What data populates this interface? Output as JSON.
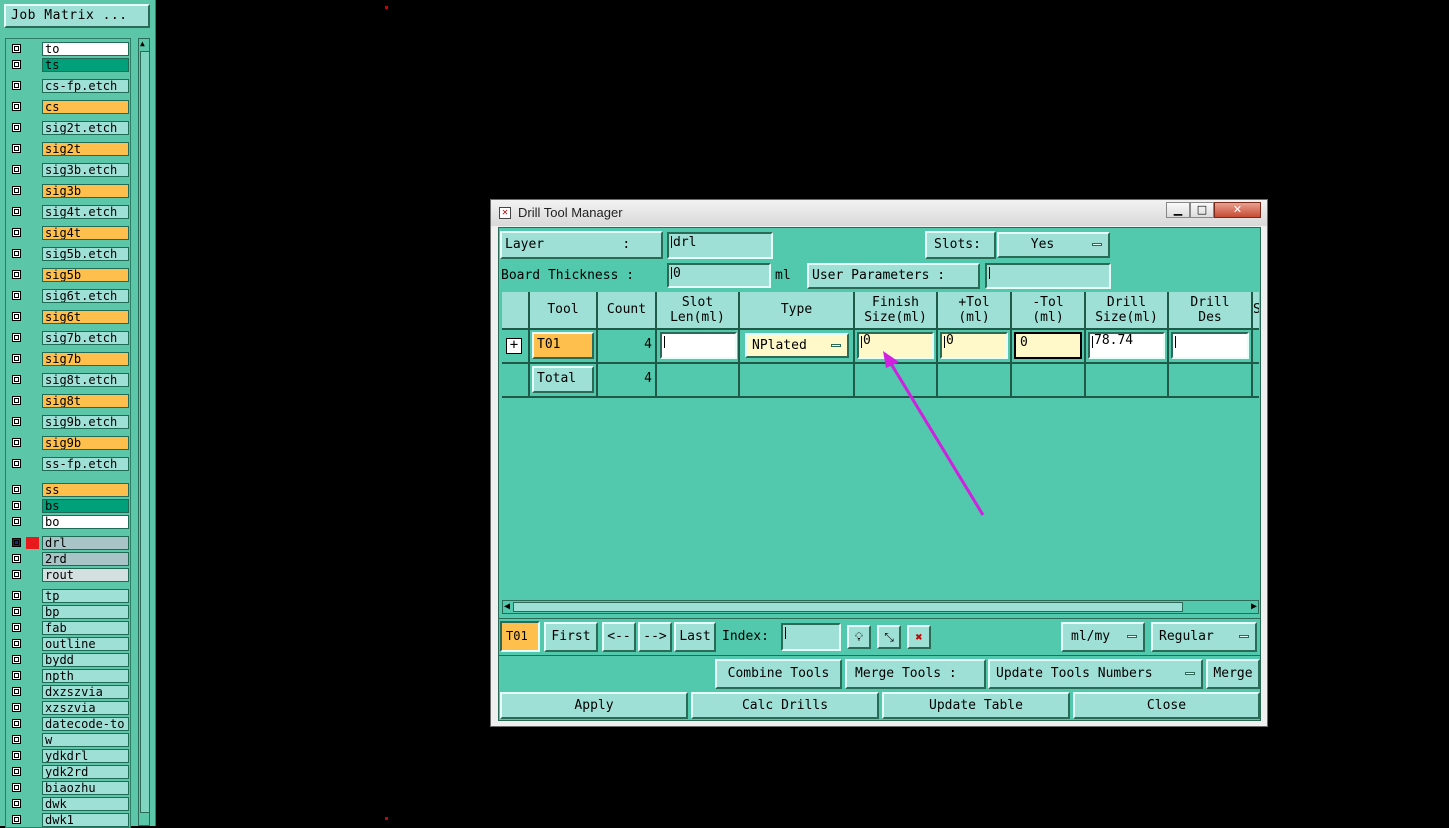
{
  "matrix_button": "Job Matrix ...",
  "layers": [
    {
      "name": "to",
      "color": "white",
      "gap": false
    },
    {
      "name": "ts",
      "color": "green",
      "gap": false
    },
    {
      "name": "cs-fp.etch",
      "color": "teal",
      "gap": true
    },
    {
      "name": "cs",
      "color": "orange",
      "gap": false
    },
    {
      "name": "sig2t.etch",
      "color": "teal",
      "gap": false
    },
    {
      "name": "sig2t",
      "color": "orange",
      "gap": false
    },
    {
      "name": "sig3b.etch",
      "color": "teal",
      "gap": false
    },
    {
      "name": "sig3b",
      "color": "orange",
      "gap": false
    },
    {
      "name": "sig4t.etch",
      "color": "teal",
      "gap": false
    },
    {
      "name": "sig4t",
      "color": "orange",
      "gap": false
    },
    {
      "name": "sig5b.etch",
      "color": "teal",
      "gap": false
    },
    {
      "name": "sig5b",
      "color": "orange",
      "gap": false
    },
    {
      "name": "sig6t.etch",
      "color": "teal",
      "gap": false
    },
    {
      "name": "sig6t",
      "color": "orange",
      "gap": false
    },
    {
      "name": "sig7b.etch",
      "color": "teal",
      "gap": false
    },
    {
      "name": "sig7b",
      "color": "orange",
      "gap": false
    },
    {
      "name": "sig8t.etch",
      "color": "teal",
      "gap": false
    },
    {
      "name": "sig8t",
      "color": "orange",
      "gap": false
    },
    {
      "name": "sig9b.etch",
      "color": "teal",
      "gap": false
    },
    {
      "name": "sig9b",
      "color": "orange",
      "gap": false
    },
    {
      "name": "ss-fp.etch",
      "color": "teal",
      "gap": false
    },
    {
      "name": "ss",
      "color": "orange",
      "gap": true
    },
    {
      "name": "bs",
      "color": "green",
      "gap": false
    },
    {
      "name": "bo",
      "color": "white",
      "gap": false
    },
    {
      "name": "drl",
      "color": "gray",
      "gap": true,
      "active": true
    },
    {
      "name": "2rd",
      "color": "gray",
      "gap": false
    },
    {
      "name": "rout",
      "color": "lgray",
      "gap": false
    },
    {
      "name": "tp",
      "color": "teal",
      "gap": true
    },
    {
      "name": "bp",
      "color": "teal",
      "gap": false
    },
    {
      "name": "fab",
      "color": "teal",
      "gap": false
    },
    {
      "name": "outline",
      "color": "teal",
      "gap": false
    },
    {
      "name": "bydd",
      "color": "teal",
      "gap": false
    },
    {
      "name": "npth",
      "color": "teal",
      "gap": false
    },
    {
      "name": "dxzszvia",
      "color": "teal",
      "gap": false
    },
    {
      "name": "xzszvia",
      "color": "teal",
      "gap": false
    },
    {
      "name": "datecode-to",
      "color": "teal",
      "gap": false
    },
    {
      "name": "w",
      "color": "teal",
      "gap": false
    },
    {
      "name": "ydkdrl",
      "color": "teal",
      "gap": false
    },
    {
      "name": "ydk2rd",
      "color": "teal",
      "gap": false
    },
    {
      "name": "biaozhu",
      "color": "teal",
      "gap": false
    },
    {
      "name": "dwk",
      "color": "teal",
      "gap": false
    },
    {
      "name": "dwk1",
      "color": "teal",
      "gap": false
    }
  ],
  "dialog": {
    "title": "Drill Tool Manager",
    "layer_label": "Layer          :",
    "layer_value": "drl",
    "slots_label": "Slots:",
    "slots_value": "Yes",
    "board_thickness_label": "Board Thickness :",
    "board_thickness_value": "0",
    "board_thickness_unit": "ml",
    "user_params_label": "User Parameters :",
    "user_params_value": "",
    "headers": {
      "tool": "Tool",
      "count": "Count",
      "slot_len_1": "Slot",
      "slot_len_2": "Len(ml)",
      "type": "Type",
      "finish_1": "Finish",
      "finish_2": "Size(ml)",
      "ptol_1": "+Tol",
      "ptol_2": "(ml)",
      "ntol_1": "-Tol",
      "ntol_2": "(ml)",
      "drill_size_1": "Drill",
      "drill_size_2": "Size(ml)",
      "drill_des_1": "Drill",
      "drill_des_2": "Des",
      "cut": "S"
    },
    "row": {
      "tool": "T01",
      "count": "4",
      "slot_len": "",
      "type": "NPlated",
      "finish_size": "0",
      "plus_tol": "0",
      "minus_tol": "0",
      "drill_size": "78.74",
      "drill_des": ""
    },
    "total": {
      "label": "Total",
      "count": "4"
    },
    "nav": {
      "current_tool": "T01",
      "first": "First",
      "prev": "<--",
      "next": "-->",
      "last": "Last",
      "index_label": "Index:",
      "index_value": "",
      "units": "ml/my",
      "mode": "Regular"
    },
    "tools_bar": {
      "combine": "Combine Tools",
      "merge_label": "Merge Tools :",
      "merge_option": "Update Tools Numbers",
      "merge": "Merge"
    },
    "actions": {
      "apply": "Apply",
      "calc": "Calc Drills",
      "update": "Update Table",
      "close": "Close"
    }
  },
  "colors": {
    "panel": "#5bc7a8",
    "button": "#9fe0d6",
    "orange": "#ffbf4d",
    "annotation_arrow": "#d020e0"
  }
}
